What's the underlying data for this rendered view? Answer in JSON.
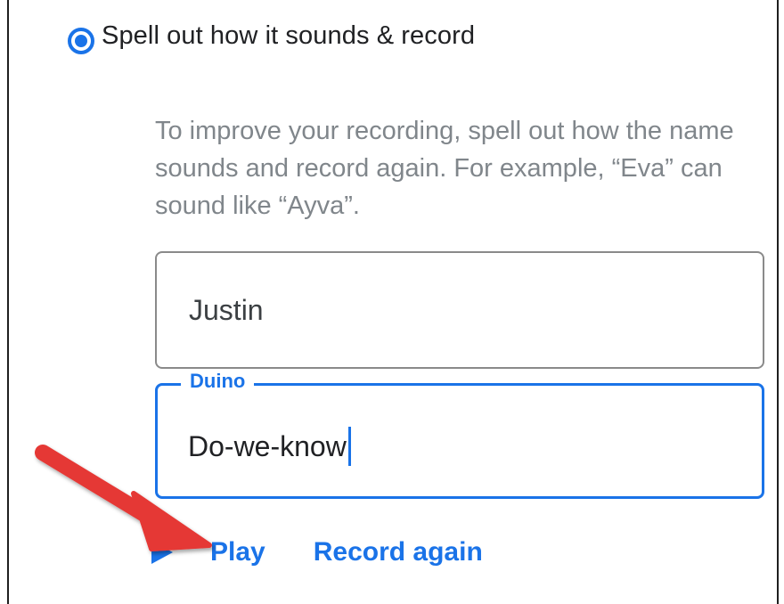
{
  "option": {
    "label": "Spell out how it sounds & record",
    "selected": true
  },
  "description": "To improve your recording, spell out how the name sounds and record again. For example, “Eva” can sound like “Ayva”.",
  "fields": {
    "first": {
      "value": "Justin"
    },
    "last": {
      "label": "Duino",
      "value": "Do-we-know"
    }
  },
  "actions": {
    "play_label": "Play",
    "record_label": "Record again"
  },
  "icons": {
    "radio": "radio-selected-icon",
    "play": "play-icon",
    "annotation": "red-arrow-annotation"
  },
  "colors": {
    "accent": "#1a73e8",
    "annotation": "#e53935",
    "text": "#202124",
    "secondary_text": "#80868b"
  }
}
